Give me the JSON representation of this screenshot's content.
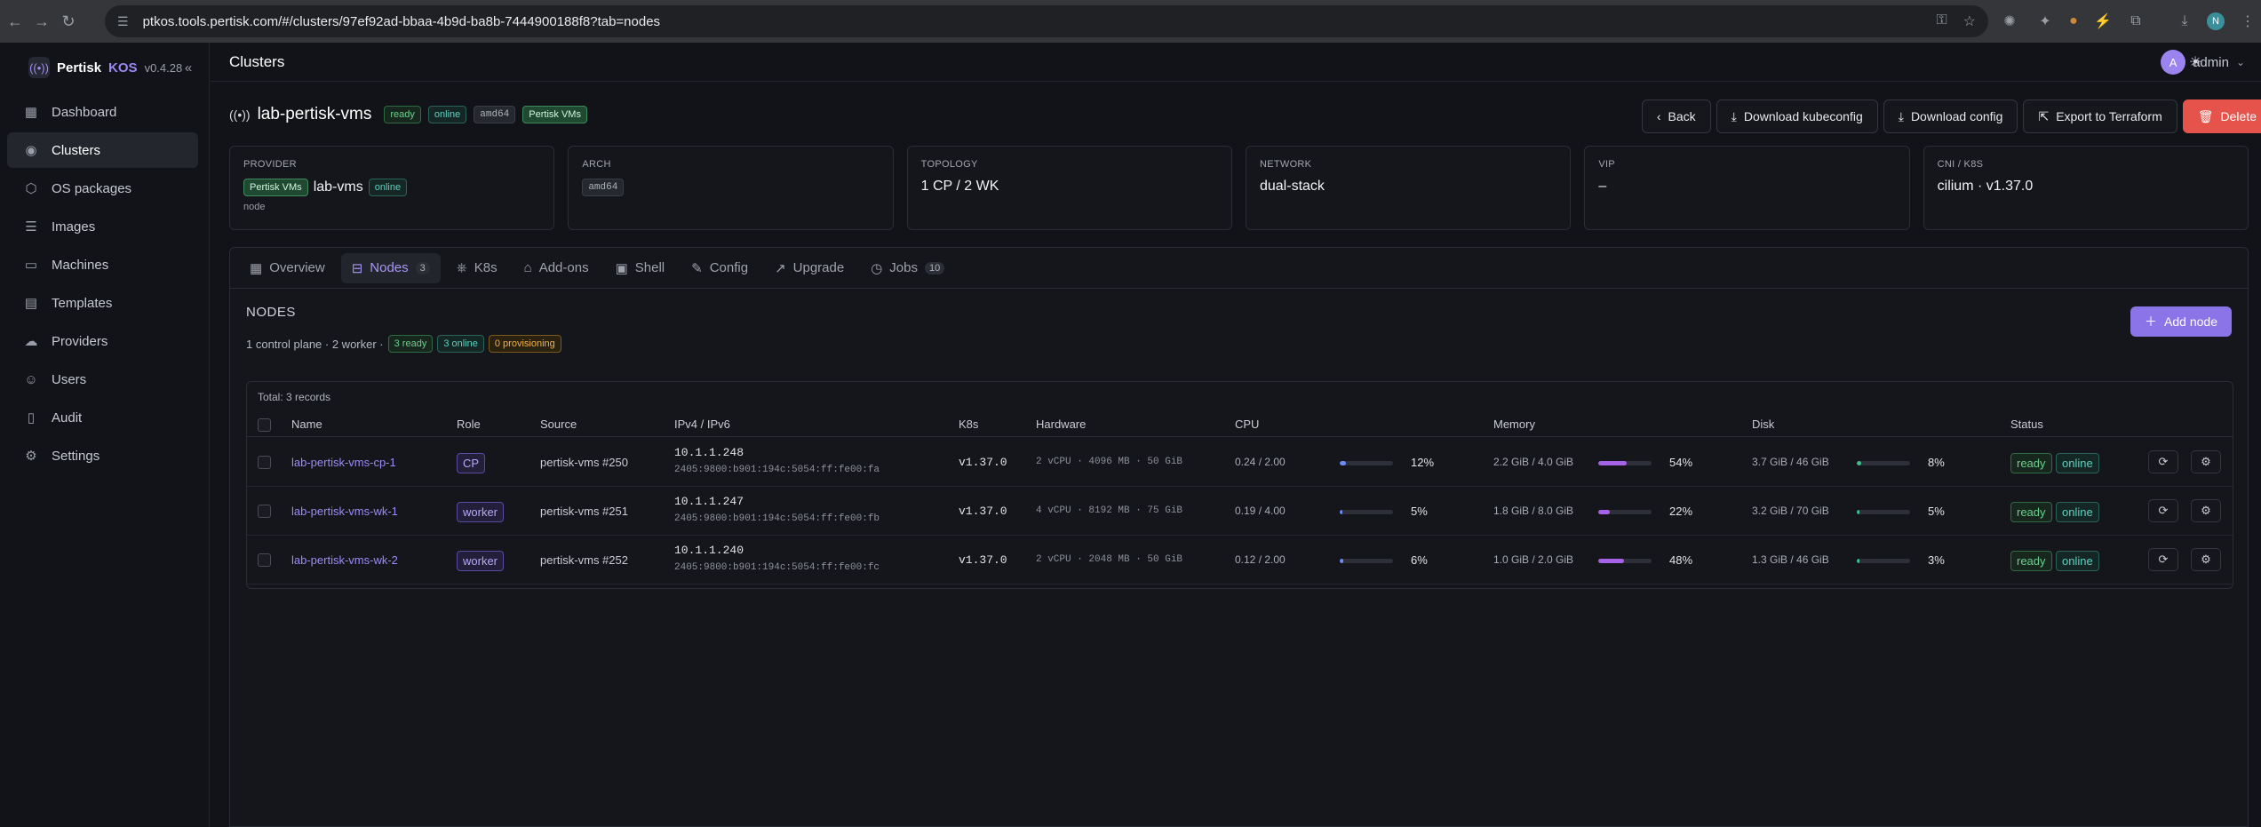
{
  "browser": {
    "url": "ptkos.tools.pertisk.com/#/clusters/97ef92ad-bbaa-4b9d-ba8b-7444900188f8?tab=nodes",
    "profile_initial": "N"
  },
  "brand": {
    "name": "Pertisk",
    "kos": "KOS",
    "version": "v0.4.28"
  },
  "sidebar": {
    "items": [
      {
        "label": "Dashboard",
        "icon": "grid-icon"
      },
      {
        "label": "Clusters",
        "icon": "radio-icon"
      },
      {
        "label": "OS packages",
        "icon": "package-icon"
      },
      {
        "label": "Images",
        "icon": "database-icon"
      },
      {
        "label": "Machines",
        "icon": "monitor-icon"
      },
      {
        "label": "Templates",
        "icon": "template-icon"
      },
      {
        "label": "Providers",
        "icon": "cloud-icon"
      },
      {
        "label": "Users",
        "icon": "users-icon"
      },
      {
        "label": "Audit",
        "icon": "clipboard-icon"
      },
      {
        "label": "Settings",
        "icon": "gear-icon"
      }
    ]
  },
  "topbar": {
    "title": "Clusters",
    "user_initial": "A",
    "user_name": "admin"
  },
  "cluster": {
    "name": "lab-pertisk-vms",
    "badges": [
      "ready",
      "online",
      "amd64",
      "Pertisk VMs"
    ]
  },
  "actions": {
    "back": "Back",
    "download_kubeconfig": "Download kubeconfig",
    "download_config": "Download config",
    "export": "Export to Terraform",
    "delete": "Delete"
  },
  "cards": {
    "provider": {
      "label": "PROVIDER",
      "tag": "Pertisk VMs",
      "value": "lab-vms",
      "status": "online",
      "sub": "node"
    },
    "arch": {
      "label": "ARCH",
      "value": "amd64"
    },
    "topology": {
      "label": "TOPOLOGY",
      "value": "1 CP / 2 WK"
    },
    "network": {
      "label": "NETWORK",
      "value": "dual-stack"
    },
    "vip": {
      "label": "VIP",
      "value": "–"
    },
    "cni": {
      "label": "CNI / K8S",
      "value": "cilium · v1.37.0"
    }
  },
  "tabs": [
    {
      "label": "Overview",
      "icon": "overview-icon"
    },
    {
      "label": "Nodes",
      "count": "3",
      "icon": "nodes-icon"
    },
    {
      "label": "K8s",
      "icon": "k8s-icon"
    },
    {
      "label": "Add-ons",
      "icon": "lock-icon"
    },
    {
      "label": "Shell",
      "icon": "terminal-icon"
    },
    {
      "label": "Config",
      "icon": "pencil-icon"
    },
    {
      "label": "Upgrade",
      "icon": "trend-icon"
    },
    {
      "label": "Jobs",
      "count": "10",
      "icon": "clock-icon"
    }
  ],
  "nodes": {
    "heading": "NODES",
    "summary": "1 control plane · 2 worker ·",
    "summary_badges": [
      "3 ready",
      "3 online",
      "0 provisioning"
    ],
    "add_label": "Add node",
    "total": "Total: 3 records",
    "columns": [
      "Name",
      "Role",
      "Source",
      "IPv4 / IPv6",
      "K8s",
      "Hardware",
      "CPU",
      "Memory",
      "Disk",
      "Status"
    ],
    "rows": [
      {
        "name": "lab-pertisk-vms-cp-1",
        "role": "CP",
        "source": "pertisk-vms #250",
        "ipv4": "10.1.1.248",
        "ipv6": "2405:9800:b901:194c:5054:ff:fe00:fa",
        "k8s": "v1.37.0",
        "hardware": "2 vCPU · 4096 MB · 50 GiB",
        "cpu": "0.24 / 2.00",
        "cpu_pct": "12%",
        "cpu_frac": 0.12,
        "mem": "2.2 GiB / 4.0 GiB",
        "mem_pct": "54%",
        "mem_frac": 0.54,
        "disk": "3.7 GiB / 46 GiB",
        "disk_pct": "8%",
        "disk_frac": 0.08,
        "status": [
          "ready",
          "online"
        ]
      },
      {
        "name": "lab-pertisk-vms-wk-1",
        "role": "worker",
        "source": "pertisk-vms #251",
        "ipv4": "10.1.1.247",
        "ipv6": "2405:9800:b901:194c:5054:ff:fe00:fb",
        "k8s": "v1.37.0",
        "hardware": "4 vCPU · 8192 MB · 75 GiB",
        "cpu": "0.19 / 4.00",
        "cpu_pct": "5%",
        "cpu_frac": 0.05,
        "mem": "1.8 GiB / 8.0 GiB",
        "mem_pct": "22%",
        "mem_frac": 0.22,
        "disk": "3.2 GiB / 70 GiB",
        "disk_pct": "5%",
        "disk_frac": 0.05,
        "status": [
          "ready",
          "online"
        ]
      },
      {
        "name": "lab-pertisk-vms-wk-2",
        "role": "worker",
        "source": "pertisk-vms #252",
        "ipv4": "10.1.1.240",
        "ipv6": "2405:9800:b901:194c:5054:ff:fe00:fc",
        "k8s": "v1.37.0",
        "hardware": "2 vCPU · 2048 MB · 50 GiB",
        "cpu": "0.12 / 2.00",
        "cpu_pct": "6%",
        "cpu_frac": 0.06,
        "mem": "1.0 GiB / 2.0 GiB",
        "mem_pct": "48%",
        "mem_frac": 0.48,
        "disk": "1.3 GiB / 46 GiB",
        "disk_pct": "3%",
        "disk_frac": 0.03,
        "status": [
          "ready",
          "online"
        ]
      }
    ]
  },
  "colors": {
    "accent": "#8b74e8",
    "cpu_bar": "#6c8cf5",
    "mem_bar": "#a763e8",
    "disk_bar": "#3fbf8f",
    "delete": "#e5534b"
  }
}
